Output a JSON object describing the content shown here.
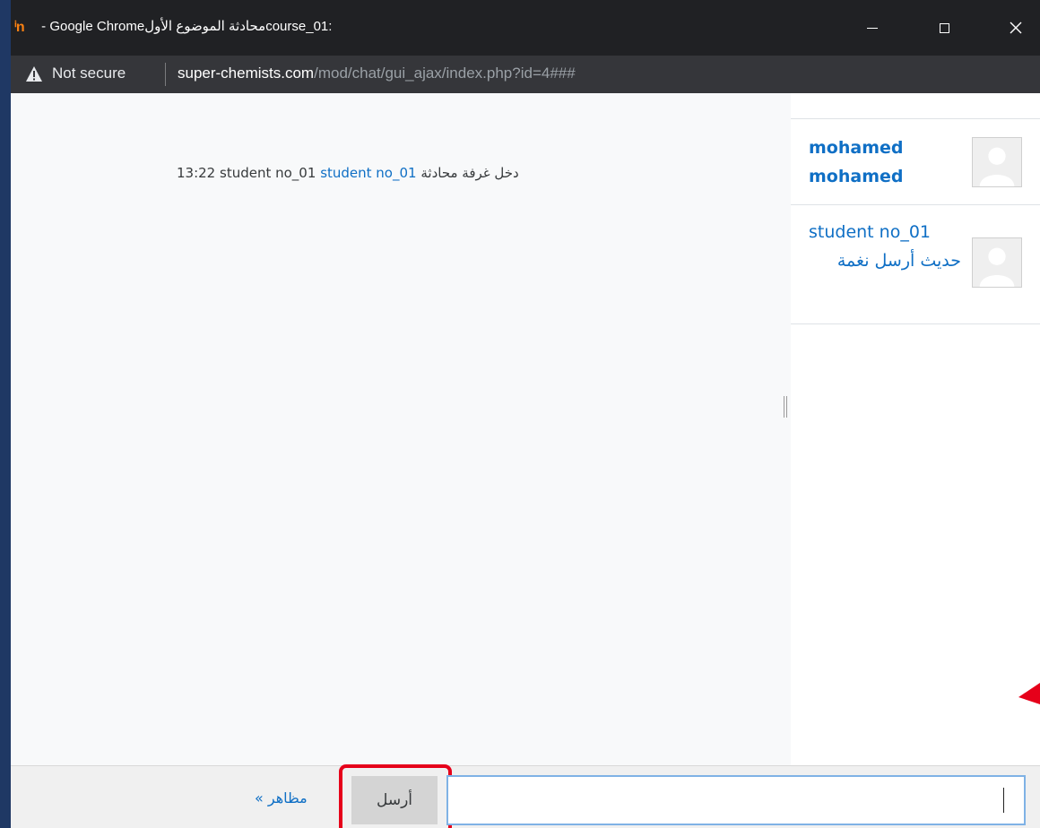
{
  "browser": {
    "title_prefix": "course_01: ",
    "title_arabic": "محادثة الموضوع الأول",
    "title_suffix": " - Google Chrome",
    "app_logo_glyph": "ⁱn",
    "security_label": "Not secure",
    "url_host": "super-chemists.com",
    "url_path": "/mod/chat/gui_ajax/index.php?id=4###"
  },
  "chat": {
    "message_time": "13:22",
    "message_user_plain": "student no_01",
    "message_user_link": "student no_01",
    "message_text": "دخل غرفة محادثة"
  },
  "users": [
    {
      "name": "mohamed mohamed"
    },
    {
      "name": "student no_01",
      "beep_label": "حديث أرسل نغمة"
    }
  ],
  "input_bar": {
    "themes_link": "مظاهر »",
    "send_label": "أرسل",
    "message_value": ""
  },
  "colors": {
    "link": "#0f6fc5",
    "highlight": "#e6001a",
    "titlebar": "#202124",
    "addressbar": "#35363a"
  }
}
